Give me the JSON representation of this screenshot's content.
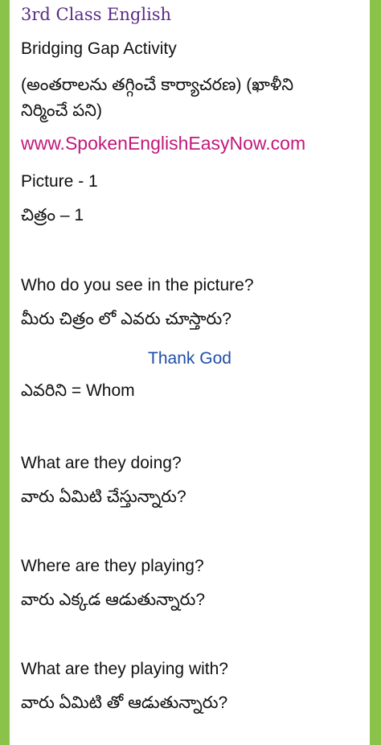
{
  "header": {
    "title": "3rd Class English",
    "subtitle": "Bridging Gap Activity",
    "telugu_subtitle_line1": "(అంతరాలను తగ్గించే కార్యాచరణ) (ఖాళీని",
    "telugu_subtitle_line2": "నిర్మించే పని)",
    "website": "www.SpokenEnglishEasyNow.com"
  },
  "picture": {
    "label_en": "Picture - 1",
    "label_te": "చిత్రం – 1"
  },
  "questions": [
    {
      "en": "Who do you see in the picture?",
      "te": "మీరు చిత్రం లో ఎవరు చూస్తారు?"
    },
    {
      "en": "What are they doing?",
      "te": "వారు ఏమిటి చేస్తున్నారు?"
    },
    {
      "en": "Where are they playing?",
      "te": "వారు ఎక్కడ ఆడుతున్నారు?"
    },
    {
      "en": "What are they playing with?",
      "te": "వారు ఏమిటి తో ఆడుతున్నారు?"
    }
  ],
  "notes": {
    "thank_god": "Thank God",
    "whom_line": "ఎవరిని = Whom"
  },
  "colors": {
    "background_border": "#8bc34a",
    "title": "#5b2a86",
    "website": "#c2187b",
    "thank_god": "#1e4fa8",
    "text": "#111111"
  }
}
